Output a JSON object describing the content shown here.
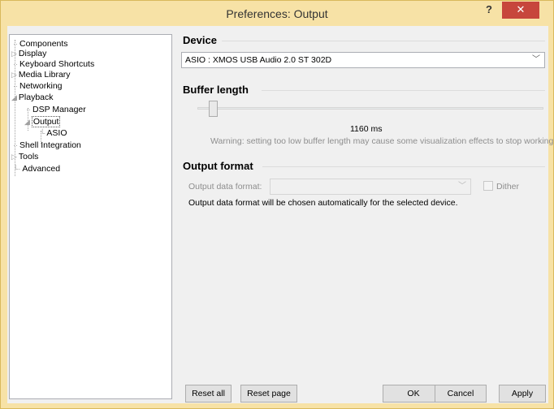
{
  "window": {
    "title": "Preferences: Output",
    "help_label": "?",
    "close_label": "✕"
  },
  "tree": {
    "items": [
      {
        "label": "Components"
      },
      {
        "label": "Display",
        "expander": "▷"
      },
      {
        "label": "Keyboard Shortcuts"
      },
      {
        "label": "Media Library",
        "expander": "▷"
      },
      {
        "label": "Networking"
      },
      {
        "label": "Playback",
        "expander": "◢"
      },
      {
        "label": "DSP Manager"
      },
      {
        "label": "Output",
        "expander": "◢"
      },
      {
        "label": "ASIO"
      },
      {
        "label": "Shell Integration"
      },
      {
        "label": "Tools",
        "expander": "▷"
      },
      {
        "label": "Advanced"
      }
    ],
    "selected": "Output"
  },
  "device": {
    "heading": "Device",
    "selected": "ASIO : XMOS USB Audio 2.0 ST 302D"
  },
  "buffer": {
    "heading": "Buffer length",
    "value_label": "1160 ms",
    "warning": "Warning: setting too low buffer length may cause some visualization effects to stop working."
  },
  "output_format": {
    "heading": "Output format",
    "data_format_label": "Output data format:",
    "data_format_value": "",
    "dither_label": "Dither",
    "dither_checked": false,
    "info": "Output data format will be chosen automatically for the selected device."
  },
  "buttons": {
    "reset_all": "Reset all",
    "reset_page": "Reset page",
    "ok": "OK",
    "cancel": "Cancel",
    "apply": "Apply"
  },
  "colors": {
    "title_bar": "#f7e2a6",
    "close_button": "#c7463c",
    "panel": "#f0f0f0"
  }
}
